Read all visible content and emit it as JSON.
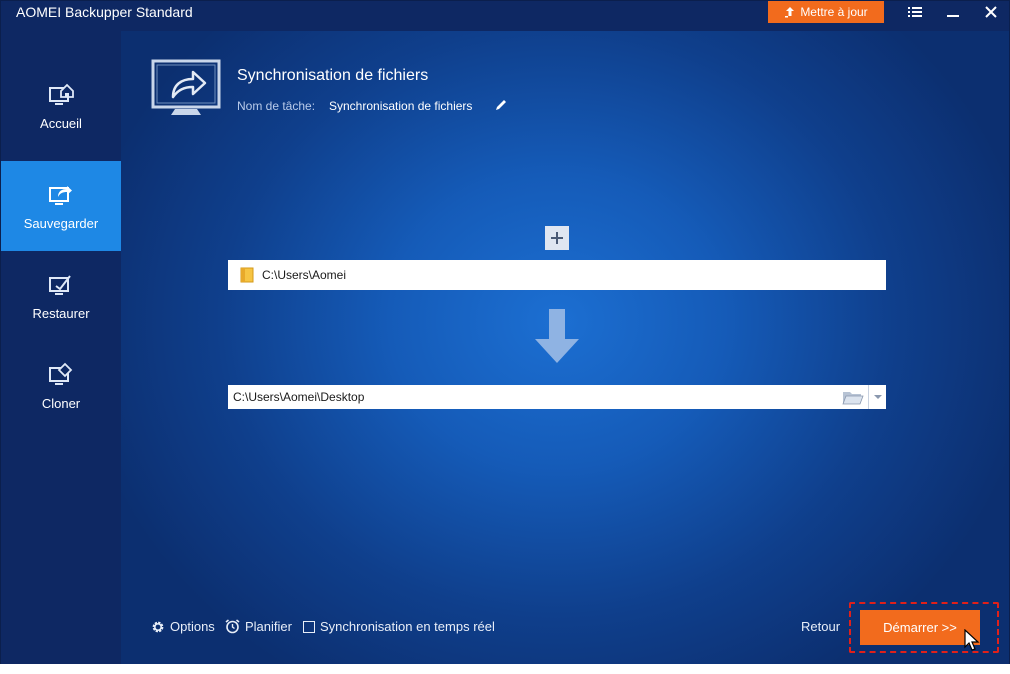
{
  "window": {
    "title": "AOMEI Backupper Standard",
    "update_label": "Mettre à jour"
  },
  "sidebar": {
    "items": [
      {
        "label": "Accueil",
        "icon": "home-monitor-icon",
        "active": false
      },
      {
        "label": "Sauvegarder",
        "icon": "backup-monitor-icon",
        "active": true
      },
      {
        "label": "Restaurer",
        "icon": "restore-monitor-icon",
        "active": false
      },
      {
        "label": "Cloner",
        "icon": "clone-monitor-icon",
        "active": false
      }
    ]
  },
  "task": {
    "title": "Synchronisation de fichiers",
    "name_label": "Nom de tâche:",
    "name_value": "Synchronisation de fichiers"
  },
  "source": {
    "path": "C:\\Users\\Aomei"
  },
  "destination": {
    "path": "C:\\Users\\Aomei\\Desktop"
  },
  "bottom": {
    "options_label": "Options",
    "schedule_label": "Planifier",
    "realtime_label": "Synchronisation en temps réel",
    "realtime_checked": false,
    "back_label": "Retour",
    "start_label": "Démarrer >>"
  },
  "colors": {
    "accent": "#f26b1d",
    "sidebar_active": "#1e88e5",
    "highlight": "#e0201a"
  }
}
